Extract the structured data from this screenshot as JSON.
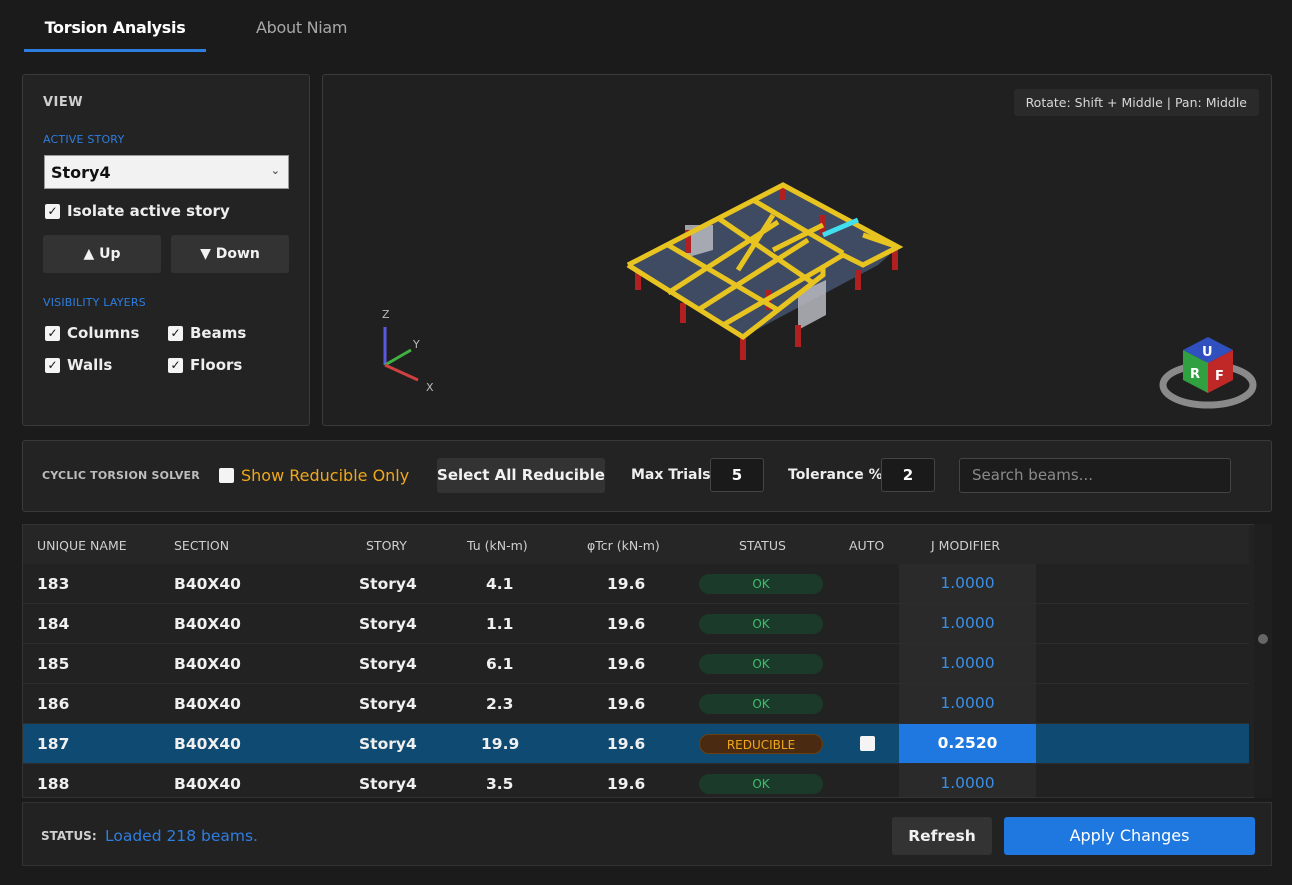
{
  "tabs": {
    "active": "Torsion Analysis",
    "second": "About Niam"
  },
  "view_panel": {
    "header": "VIEW",
    "active_story_label": "ACTIVE STORY",
    "active_story_value": "Story4",
    "isolate_label": "Isolate active story",
    "up_label": "▲ Up",
    "down_label": "▼ Down",
    "layers_label": "VISIBILITY LAYERS",
    "layers": {
      "columns": "Columns",
      "beams": "Beams",
      "walls": "Walls",
      "floors": "Floors"
    }
  },
  "viewport": {
    "hint": "Rotate: Shift + Middle  |  Pan: Middle",
    "axes": {
      "z": "Z",
      "y": "Y",
      "x": "X"
    },
    "cube": {
      "top": "U",
      "left": "R",
      "right": "F"
    }
  },
  "solver": {
    "label": "CYCLIC TORSION SOLVER",
    "show_reducible_label": "Show Reducible Only",
    "select_all_label": "Select All Reducible",
    "max_trials_label": "Max Trials",
    "max_trials_value": "5",
    "tolerance_label": "Tolerance %",
    "tolerance_value": "2",
    "search_placeholder": "Search beams..."
  },
  "table": {
    "columns": [
      "UNIQUE NAME",
      "SECTION",
      "STORY",
      "Tu (kN-m)",
      "φTcr (kN-m)",
      "STATUS",
      "AUTO",
      "J MODIFIER"
    ],
    "rows": [
      {
        "name": "183",
        "section": "B40X40",
        "story": "Story4",
        "tu": "4.1",
        "tcr": "19.6",
        "status": "OK",
        "j": "1.0000"
      },
      {
        "name": "184",
        "section": "B40X40",
        "story": "Story4",
        "tu": "1.1",
        "tcr": "19.6",
        "status": "OK",
        "j": "1.0000"
      },
      {
        "name": "185",
        "section": "B40X40",
        "story": "Story4",
        "tu": "6.1",
        "tcr": "19.6",
        "status": "OK",
        "j": "1.0000"
      },
      {
        "name": "186",
        "section": "B40X40",
        "story": "Story4",
        "tu": "2.3",
        "tcr": "19.6",
        "status": "OK",
        "j": "1.0000"
      },
      {
        "name": "187",
        "section": "B40X40",
        "story": "Story4",
        "tu": "19.9",
        "tcr": "19.6",
        "status": "REDUCIBLE",
        "j": "0.2520"
      },
      {
        "name": "188",
        "section": "B40X40",
        "story": "Story4",
        "tu": "3.5",
        "tcr": "19.6",
        "status": "OK",
        "j": "1.0000"
      }
    ]
  },
  "status_bar": {
    "label": "STATUS:",
    "message": "Loaded 218 beams.",
    "refresh_label": "Refresh",
    "apply_label": "Apply Changes"
  },
  "colors": {
    "accent": "#2e7ee0",
    "ok": "#3fbf6d",
    "reducible": "#f0a81a",
    "selected_row": "#0f4a73"
  }
}
